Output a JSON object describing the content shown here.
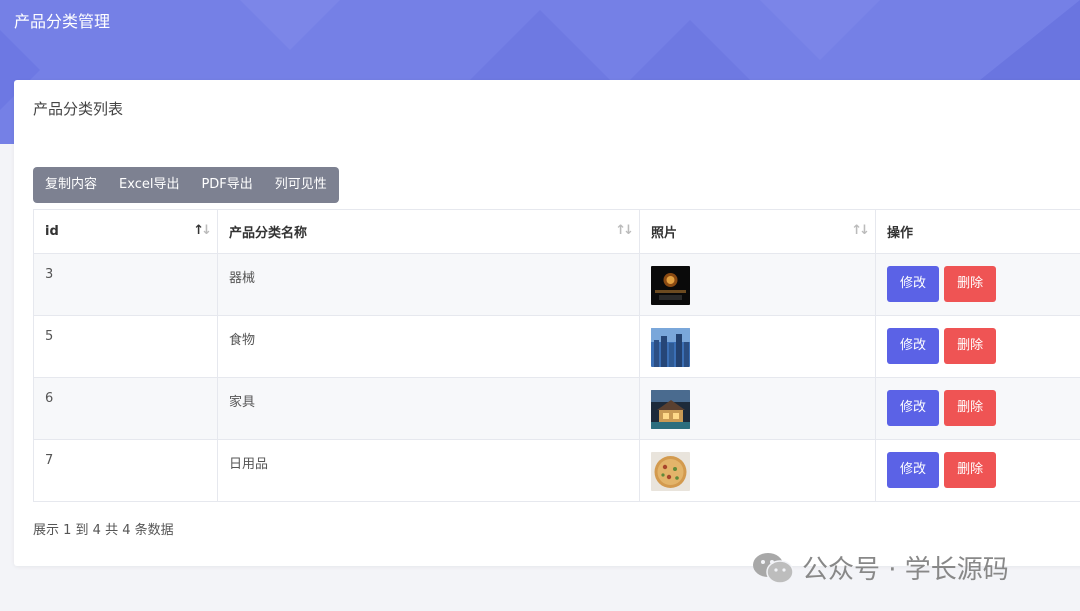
{
  "header": {
    "title": "产品分类管理"
  },
  "card": {
    "title": "产品分类列表"
  },
  "toolbar": {
    "copy_label": "复制内容",
    "excel_label": "Excel导出",
    "pdf_label": "PDF导出",
    "columns_label": "列可见性"
  },
  "table": {
    "columns": [
      "id",
      "产品分类名称",
      "照片",
      "操作"
    ],
    "rows": [
      {
        "id": "3",
        "name": "器械",
        "photo_icon": "equipment-photo"
      },
      {
        "id": "5",
        "name": "食物",
        "photo_icon": "city-photo"
      },
      {
        "id": "6",
        "name": "家具",
        "photo_icon": "house-photo"
      },
      {
        "id": "7",
        "name": "日用品",
        "photo_icon": "pizza-photo"
      }
    ],
    "edit_label": "修改",
    "delete_label": "删除"
  },
  "footer": {
    "info": "展示 1 到 4 共 4 条数据"
  },
  "watermark": {
    "text": "公众号 · 学长源码"
  },
  "colors": {
    "header_bg": "#7580e6",
    "toolbar_bg": "#7d8191",
    "edit_button": "#5b62e6",
    "delete_button": "#ef5454"
  }
}
